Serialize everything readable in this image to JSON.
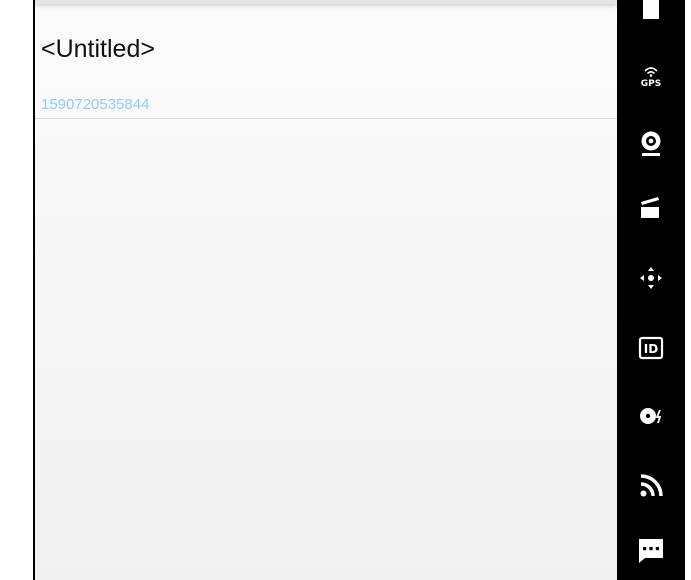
{
  "document": {
    "title": "<Untitled>",
    "id": "1590720535844"
  },
  "toolbar": {
    "items": [
      {
        "icon": "battery-icon"
      },
      {
        "icon": "gps-icon",
        "label": "GPS"
      },
      {
        "icon": "webcam-icon"
      },
      {
        "icon": "clapperboard-icon"
      },
      {
        "icon": "dpad-icon"
      },
      {
        "icon": "id-icon",
        "label": "ID"
      },
      {
        "icon": "disc-power-icon"
      },
      {
        "icon": "cast-icon"
      },
      {
        "icon": "more-icon"
      }
    ]
  },
  "colors": {
    "toolbar_bg": "#000000",
    "id_text": "#8fcdf0",
    "title_text": "#111111"
  }
}
